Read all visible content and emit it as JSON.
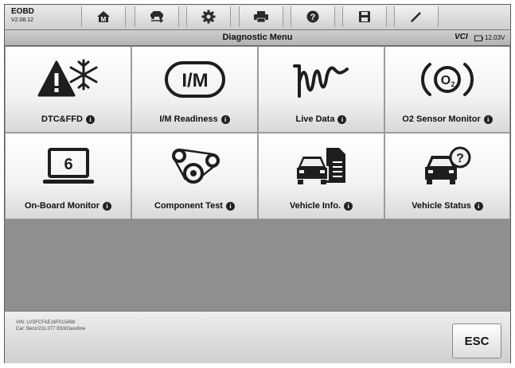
{
  "app": {
    "name": "EOBD",
    "version": "V2.08.12"
  },
  "toolbar": {
    "home_icon": "home-icon",
    "vehicle_swap_icon": "vehicle-swap-icon",
    "settings_icon": "gear-icon",
    "print_icon": "printer-icon",
    "help_icon": "help-icon",
    "save_icon": "save-icon",
    "data_logging_icon": "pen-icon"
  },
  "header": {
    "title": "Diagnostic Menu",
    "vci_label": "VCI",
    "voltage": "12.03V"
  },
  "menu": [
    {
      "label": "DTC&FFD",
      "icon": "warning-snowflake-icon"
    },
    {
      "label": "I/M Readiness",
      "icon": "im-icon"
    },
    {
      "label": "Live Data",
      "icon": "waveform-icon"
    },
    {
      "label": "O2 Sensor Monitor",
      "icon": "o2-sensor-icon"
    },
    {
      "label": "On-Board Monitor",
      "icon": "monitor-six-icon"
    },
    {
      "label": "Component Test",
      "icon": "belt-pulley-icon"
    },
    {
      "label": "Vehicle Info.",
      "icon": "vehicle-document-icon"
    },
    {
      "label": "Vehicle Status",
      "icon": "vehicle-question-icon"
    }
  ],
  "footer": {
    "vin": "VIN: LVSFCFAE16F015498",
    "car": "Car: Benz/211.077 E63/Gasoline",
    "esc_label": "ESC"
  },
  "colors": {
    "background": "#8f8f8f",
    "tile": "#f5f5f5",
    "text": "#111111"
  }
}
